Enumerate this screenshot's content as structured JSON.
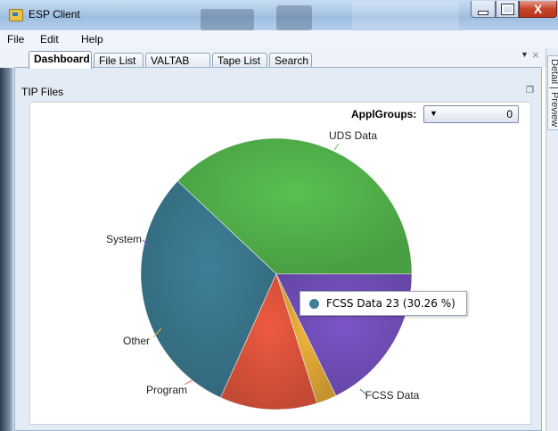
{
  "window": {
    "title": "ESP Client",
    "close_glyph": "X"
  },
  "menu": [
    "File",
    "Edit",
    "Help"
  ],
  "tabs": [
    {
      "label": "Dashboard",
      "active": true
    },
    {
      "label": "File List"
    },
    {
      "label": "VALTAB List"
    },
    {
      "label": "Tape List"
    },
    {
      "label": "Search"
    }
  ],
  "side_panel": {
    "label": "Detail | Preview"
  },
  "panel": {
    "title": "TIP Files"
  },
  "filter": {
    "label": "ApplGroups:",
    "value": "0"
  },
  "tooltip": {
    "text": "FCSS Data 23  (30.26 %)"
  },
  "icons": [
    "app-icon",
    "minimize-icon",
    "maximize-icon",
    "close-icon",
    "tab-dropdown-icon",
    "tab-close-icon",
    "restore-icon",
    "dropdown-arrow-icon"
  ],
  "chart_data": {
    "type": "pie",
    "slices": [
      {
        "label": "UDS Data",
        "value": 38.0,
        "color": "#58c151"
      },
      {
        "label": "FCSS Data",
        "value": 30.26,
        "color": "#3e7f97"
      },
      {
        "label": "Program",
        "value": 11.6,
        "color": "#ee5a40"
      },
      {
        "label": "Other",
        "value": 2.4,
        "color": "#f0b43a"
      },
      {
        "label": "System",
        "value": 17.74,
        "color": "#7b55c8"
      }
    ],
    "start_angle_deg": 0,
    "legend": "none"
  }
}
